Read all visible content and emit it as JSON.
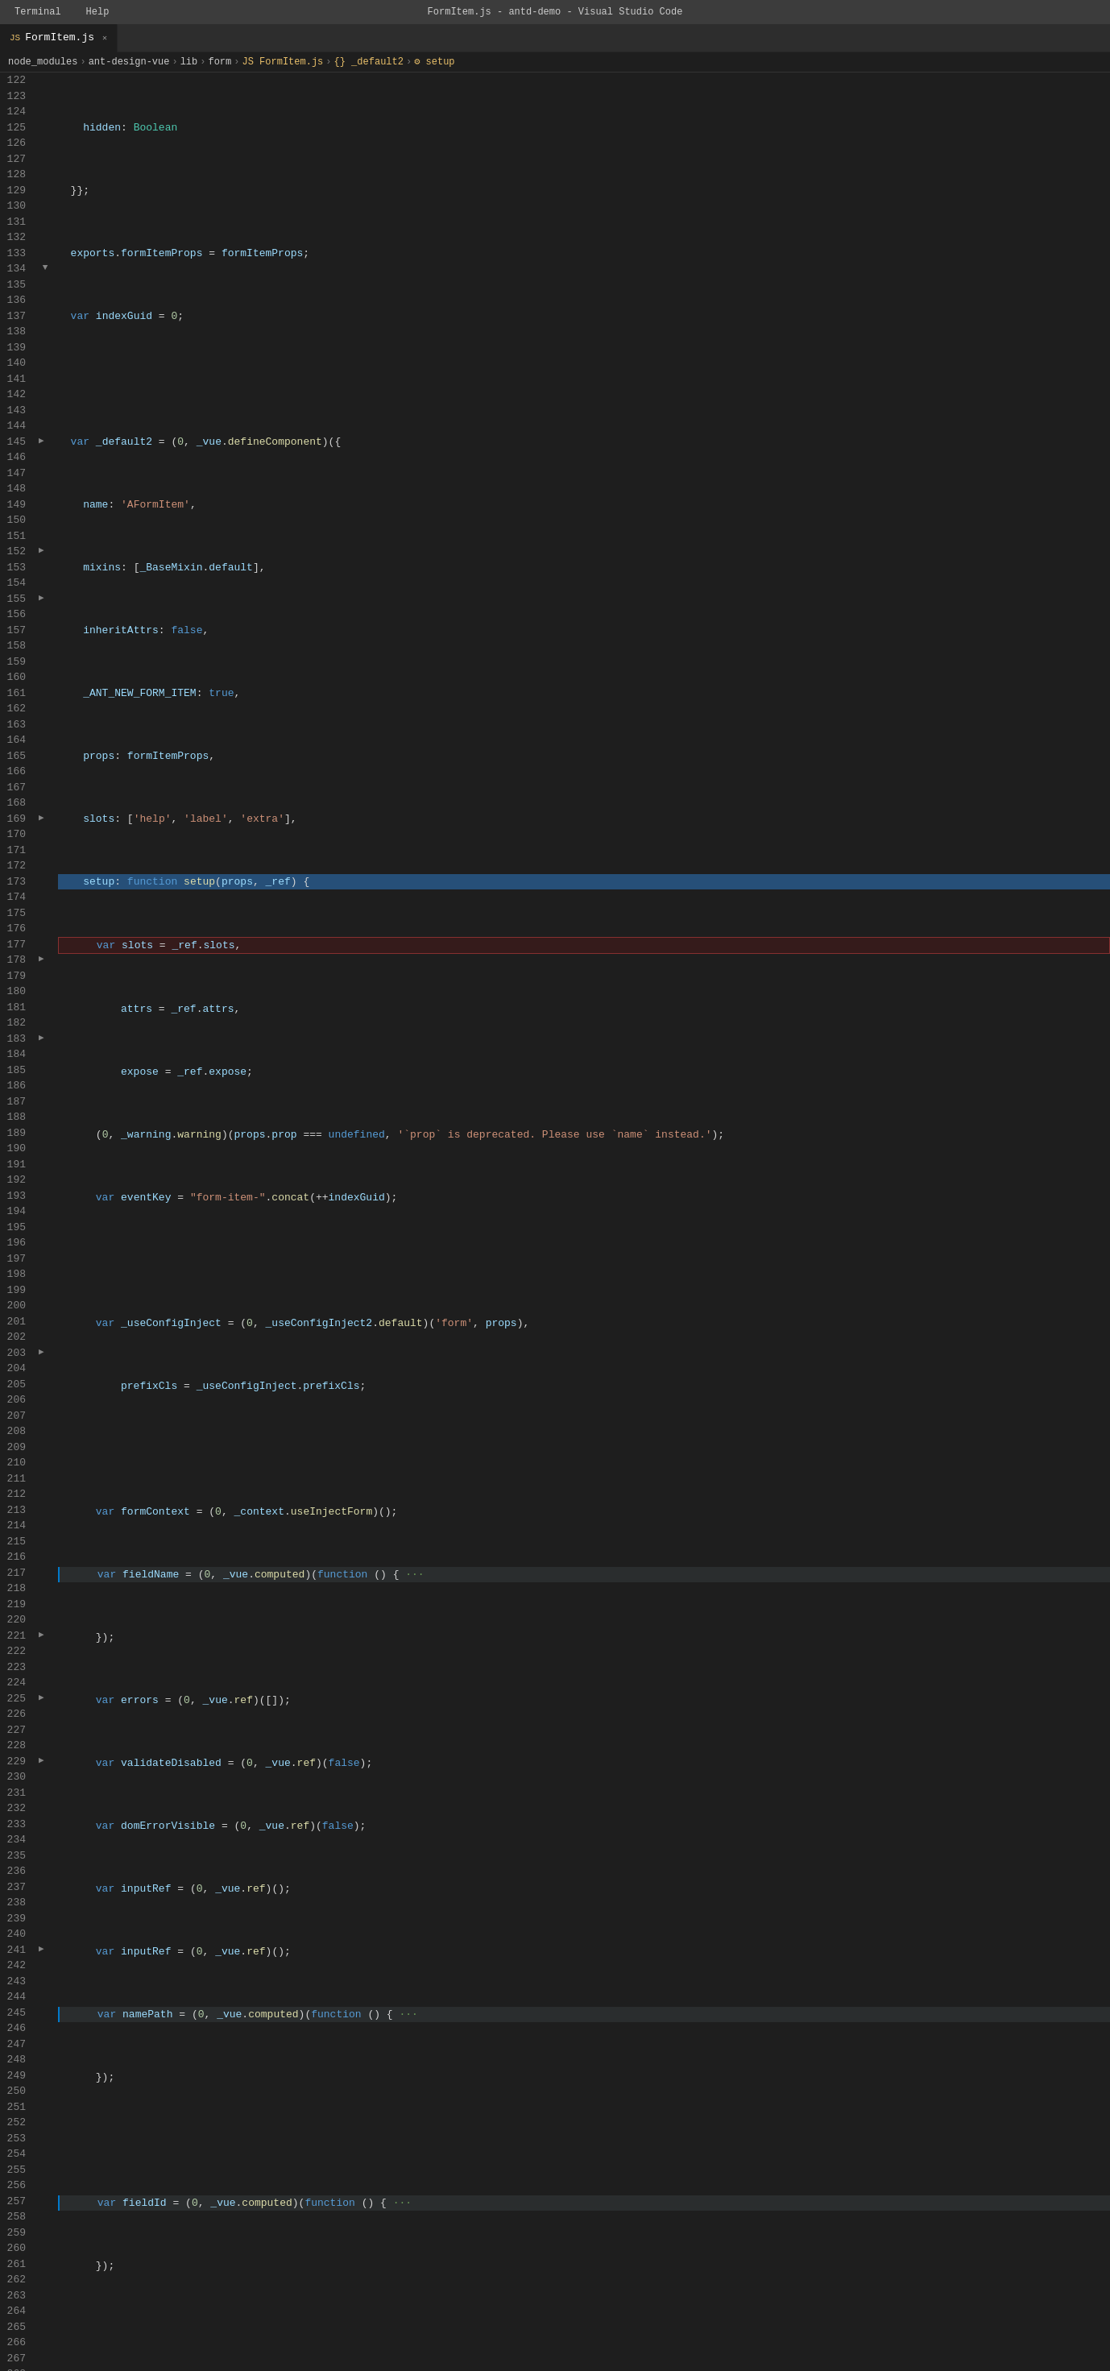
{
  "titleBar": {
    "left": "Terminal  Help",
    "center": "FormItem.js - antd-demo - Visual Studio Code"
  },
  "tab": {
    "label": "FormItem.js",
    "icon": "JS",
    "modified": false
  },
  "breadcrumb": {
    "parts": [
      "node_modules",
      "ant-design-vue",
      "lib",
      "form",
      "FormItem.js",
      "_default2",
      "setup"
    ]
  },
  "colors": {
    "background": "#1e1e1e",
    "lineHighlight": "#264f78",
    "errorBorder": "#ff5050",
    "tabActive": "#1e1e1e",
    "tabBar": "#2d2d2d"
  }
}
